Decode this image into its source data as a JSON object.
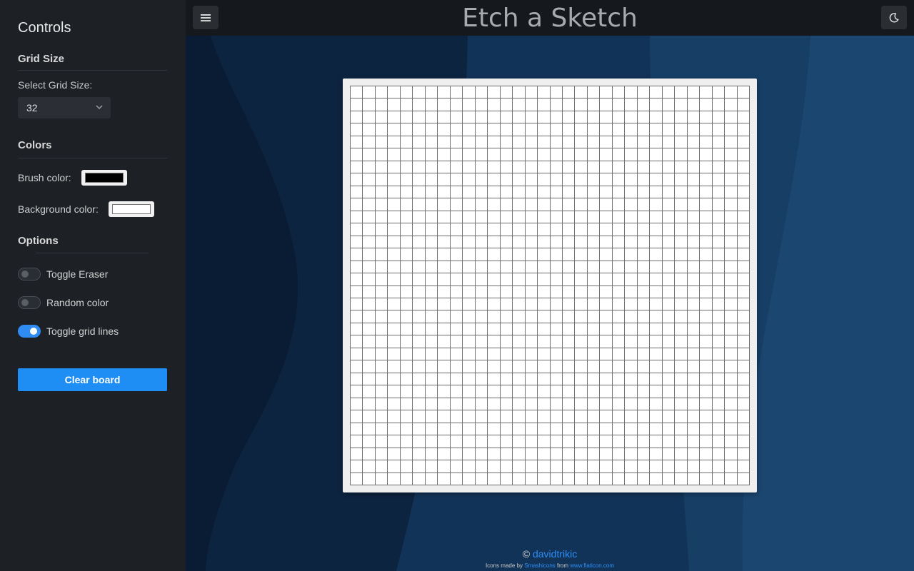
{
  "sidebar": {
    "title": "Controls",
    "grid_section": "Grid Size",
    "grid_label": "Select Grid Size:",
    "grid_value": "32",
    "colors_section": "Colors",
    "brush_label": "Brush color:",
    "brush_color": "#000000",
    "background_label": "Background color:",
    "background_color": "#ffffff",
    "options_section": "Options",
    "toggles": [
      {
        "label": "Toggle Eraser",
        "on": false
      },
      {
        "label": "Random color",
        "on": false
      },
      {
        "label": "Toggle grid lines",
        "on": true
      }
    ],
    "clear_button": "Clear board"
  },
  "header": {
    "title": "Etch a Sketch",
    "menu_icon": "hamburger-icon",
    "theme_icon": "moon-icon"
  },
  "board": {
    "grid_size": 32
  },
  "footer": {
    "copyright": "©",
    "author": "davidtrikic",
    "credits_prefix": "Icons made by",
    "credits_author": "Smashicons",
    "credits_from": "from",
    "credits_site": "www.flaticon.com"
  },
  "colors": {
    "accent": "#1e8ef5",
    "sidebar_bg": "#1d2025",
    "header_bg": "#15181c"
  }
}
